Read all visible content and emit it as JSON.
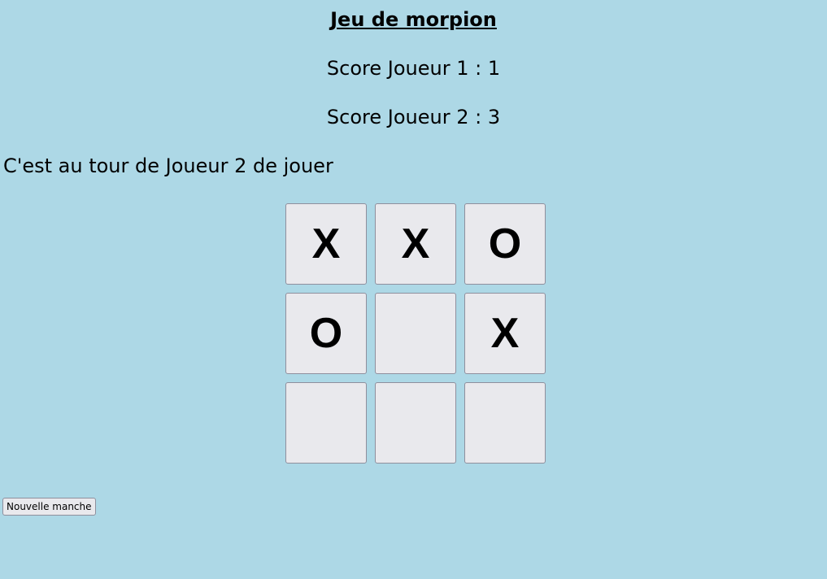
{
  "game": {
    "title": "Jeu de morpion",
    "score_player1": "Score Joueur 1 : 1",
    "score_player2": "Score Joueur 2 : 3",
    "turn_message": "C'est au tour de Joueur 2 de jouer"
  },
  "board": {
    "cells": [
      "X",
      "X",
      "O",
      "O",
      "",
      "X",
      "",
      "",
      ""
    ]
  },
  "controls": {
    "new_round_label": "Nouvelle manche"
  },
  "colors": {
    "background": "#add8e6",
    "cell_background": "#e9e9ed",
    "cell_border": "#8f8f9d"
  }
}
